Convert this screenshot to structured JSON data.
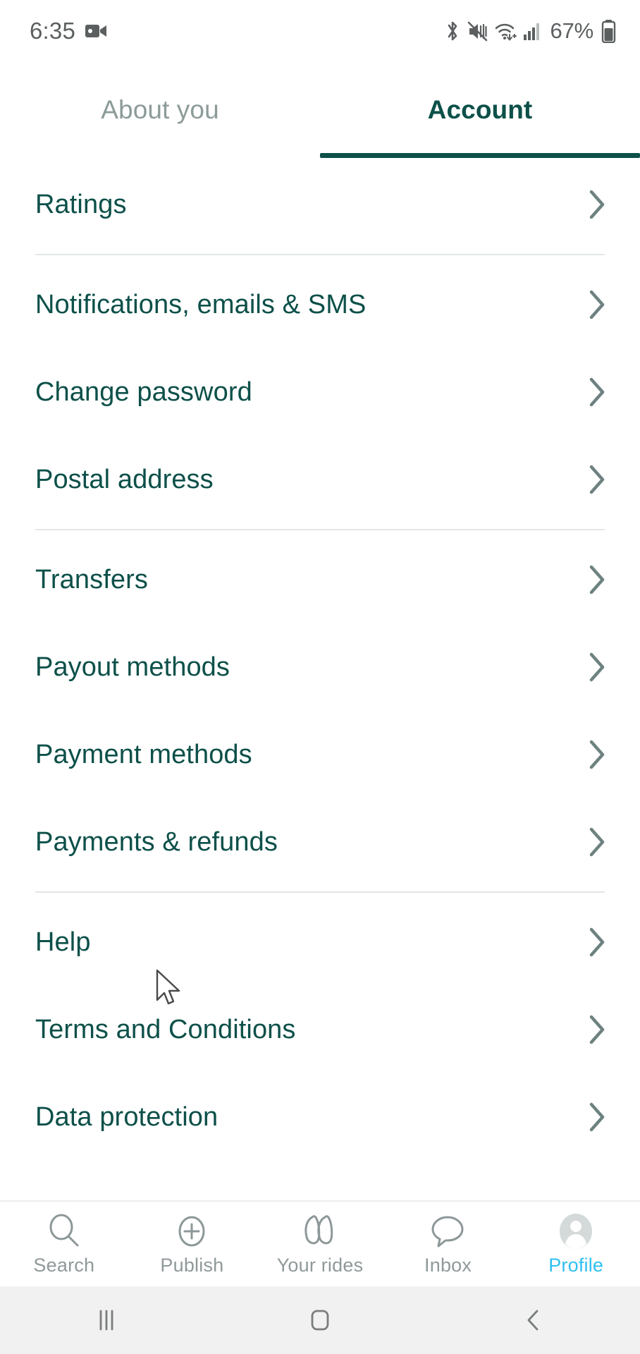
{
  "status_bar": {
    "clock": "6:35",
    "battery_percent": "67%",
    "icons": [
      "screen-record-icon",
      "bluetooth-icon",
      "vibrate-mute-icon",
      "wifi-icon",
      "cellular-signal-icon",
      "battery-icon"
    ]
  },
  "tabs": [
    {
      "label": "About you",
      "active": false
    },
    {
      "label": "Account",
      "active": true
    }
  ],
  "groups": [
    {
      "rows": [
        {
          "label": "Ratings"
        }
      ]
    },
    {
      "rows": [
        {
          "label": "Notifications, emails & SMS"
        },
        {
          "label": "Change password"
        },
        {
          "label": "Postal address"
        }
      ]
    },
    {
      "rows": [
        {
          "label": "Transfers"
        },
        {
          "label": "Payout methods"
        },
        {
          "label": "Payment methods"
        },
        {
          "label": "Payments & refunds"
        }
      ]
    },
    {
      "rows": [
        {
          "label": "Help"
        },
        {
          "label": "Terms and Conditions"
        },
        {
          "label": "Data protection"
        }
      ]
    }
  ],
  "bottom_nav": [
    {
      "label": "Search",
      "icon": "search-icon",
      "active": false
    },
    {
      "label": "Publish",
      "icon": "plus-circle-icon",
      "active": false
    },
    {
      "label": "Your rides",
      "icon": "rides-icon",
      "active": false
    },
    {
      "label": "Inbox",
      "icon": "chat-bubble-icon",
      "active": false
    },
    {
      "label": "Profile",
      "icon": "avatar-icon",
      "active": true
    }
  ],
  "system_bar": {
    "recents": "recents-icon",
    "home": "home-icon",
    "back": "back-icon"
  },
  "colors": {
    "brand_teal": "#0d5049",
    "tab_inactive": "#8c9b99",
    "accent_cyan": "#2fc0f0",
    "divider": "#e3e6e6",
    "chevron": "#6d8280",
    "nav_label": "#90999a",
    "background": "#ffffff",
    "system_bar": "#f1f1f1"
  }
}
